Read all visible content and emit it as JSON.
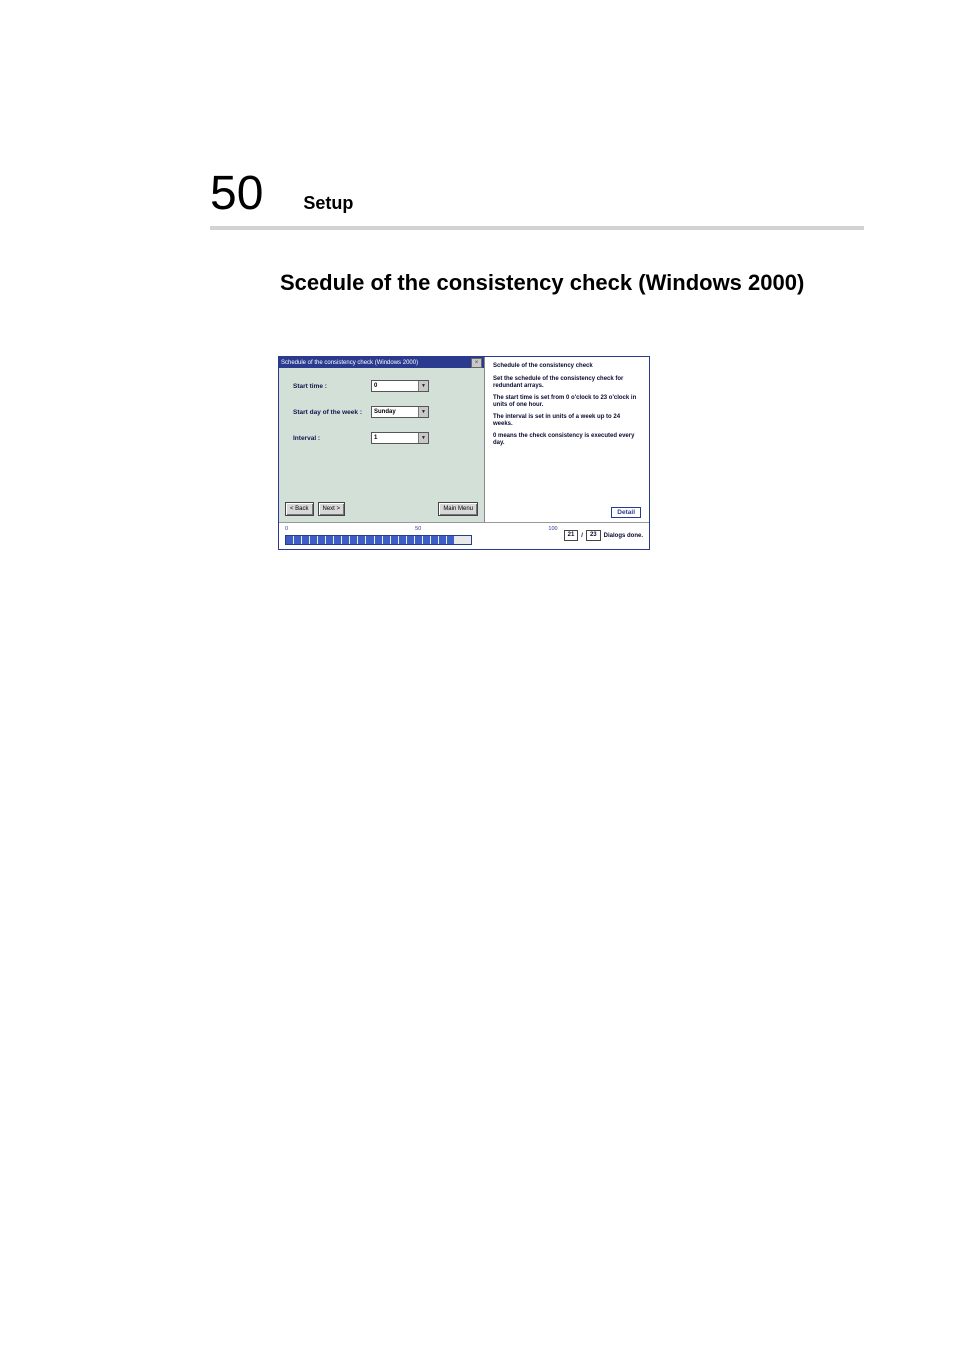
{
  "header": {
    "page_number": "50",
    "section": "Setup"
  },
  "title": "Scedule of the consistency check (Windows 2000)",
  "dialog": {
    "titlebar": "Schedule of the consistency check (Windows 2000)",
    "fields": {
      "start_time_label": "Start time :",
      "start_time_value": "0",
      "start_day_label": "Start day of the week :",
      "start_day_value": "Sunday",
      "interval_label": "Interval :",
      "interval_value": "1"
    },
    "buttons": {
      "back": "< Back",
      "next": "Next >",
      "main_menu": "Main Menu"
    }
  },
  "info": {
    "heading": "Schedule of the consistency check",
    "p1": "Set the schedule of the consistency check for redundant arrays.",
    "p2": "The start time is set from 0 o'clock to 23 o'clock in units of one hour.",
    "p3": "The interval is set in units of a week up to 24 weeks.",
    "p4": "0 means the check consistency is executed every day.",
    "detail_button": "Detail"
  },
  "progress": {
    "label_0": "0",
    "label_50": "50",
    "label_100": "100",
    "current": "21",
    "sep": "/",
    "total": "23",
    "status_text": "Dialogs done."
  }
}
